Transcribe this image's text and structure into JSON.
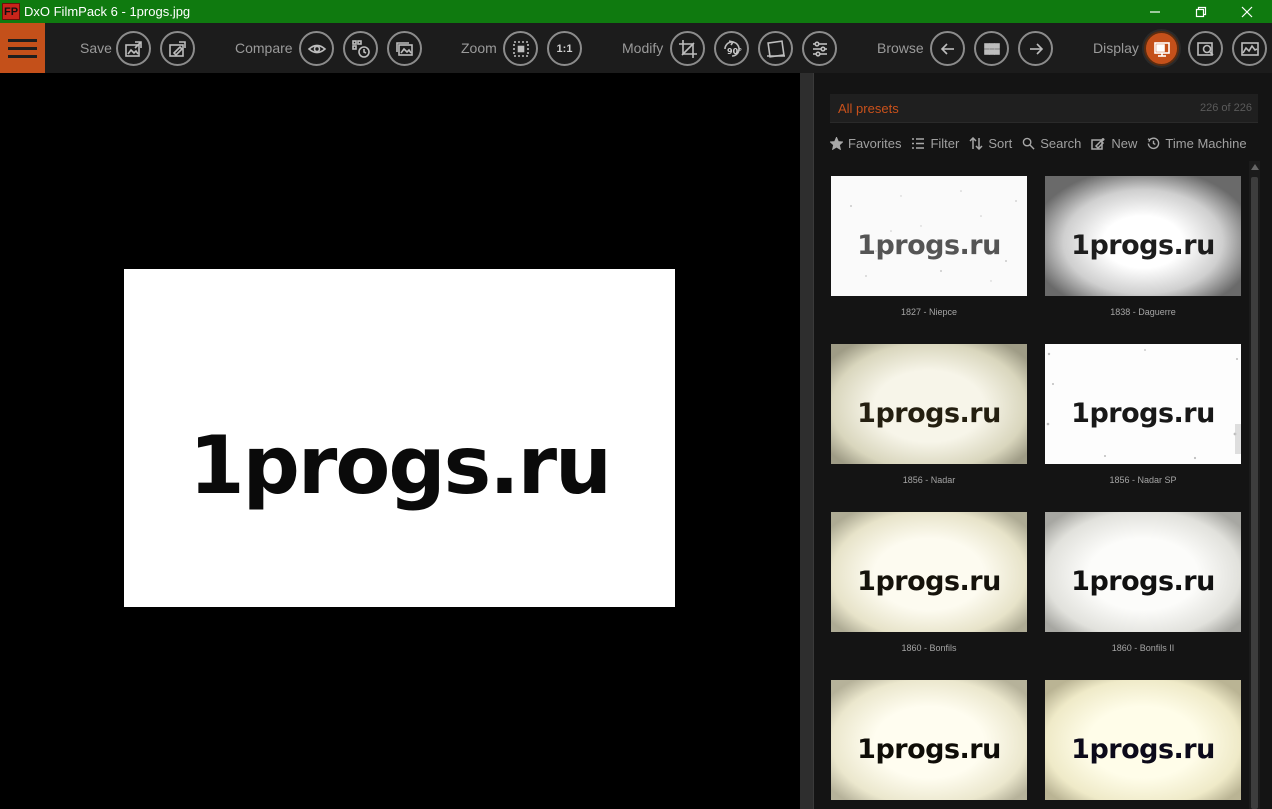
{
  "window": {
    "app_icon_text": "FP",
    "title": "DxO FilmPack 6 - 1progs.jpg"
  },
  "toolbar": {
    "groups": {
      "save": "Save",
      "compare": "Compare",
      "zoom": "Zoom",
      "modify": "Modify",
      "browse": "Browse",
      "display": "Display"
    },
    "zoom_one_to_one": "1:1",
    "rotate_label": "90°"
  },
  "viewer": {
    "image_text": "1progs.ru"
  },
  "presets": {
    "title": "All presets",
    "count": "226 of 226",
    "tools": {
      "favorites": "Favorites",
      "filter": "Filter",
      "sort": "Sort",
      "search": "Search",
      "new": "New",
      "time_machine": "Time Machine"
    },
    "items": [
      {
        "label": "1827 - Niepce",
        "thumb_text": "1progs.ru"
      },
      {
        "label": "1838 - Daguerre",
        "thumb_text": "1progs.ru"
      },
      {
        "label": "1856 - Nadar",
        "thumb_text": "1progs.ru"
      },
      {
        "label": "1856 - Nadar SP",
        "thumb_text": "1progs.ru"
      },
      {
        "label": "1860 - Bonfils",
        "thumb_text": "1progs.ru"
      },
      {
        "label": "1860 - Bonfils II",
        "thumb_text": "1progs.ru"
      },
      {
        "label": "",
        "thumb_text": "1progs.ru"
      },
      {
        "label": "",
        "thumb_text": "1progs.ru"
      }
    ]
  },
  "colors": {
    "titlebar": "#0f7a0f",
    "accent": "#c4501a",
    "toolbar_bg": "#1c1c1c",
    "panel_bg": "#141414"
  }
}
